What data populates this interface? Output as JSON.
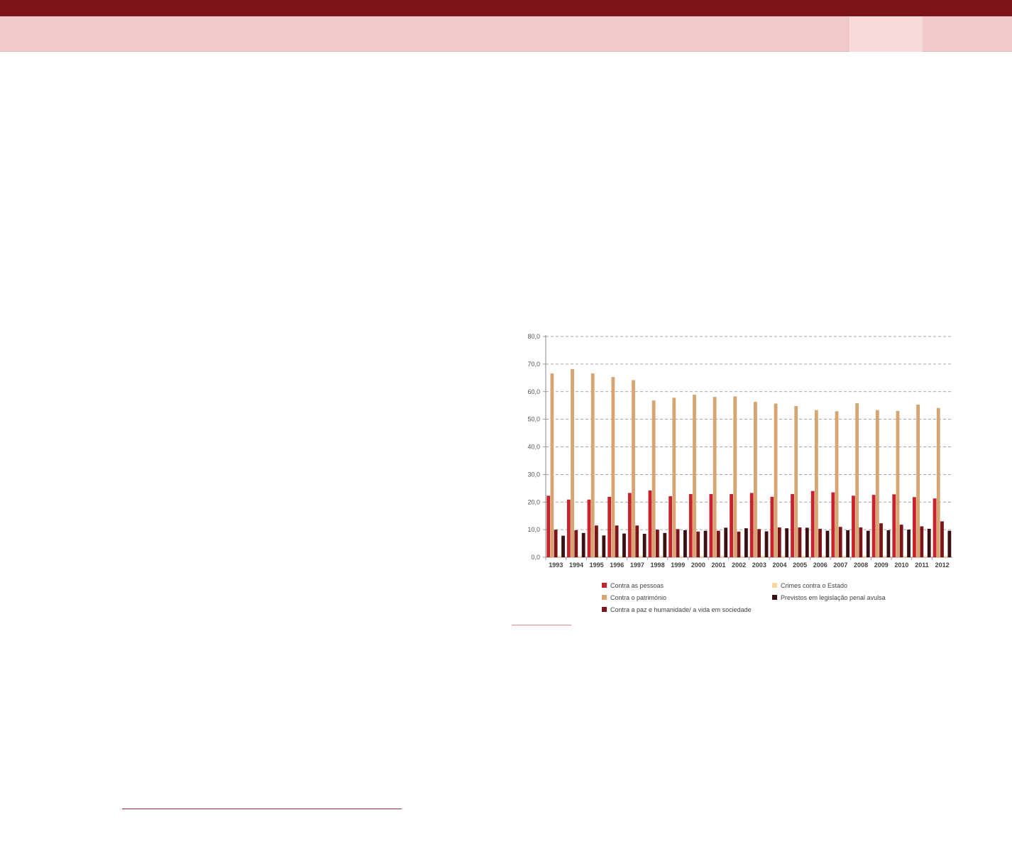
{
  "colors": {
    "header_dark": "#7d1518",
    "header_light": "#f2c9ca",
    "accent_rule": "#a3272b"
  },
  "chart_data": {
    "type": "bar",
    "categories": [
      "1993",
      "1994",
      "1995",
      "1996",
      "1997",
      "1998",
      "1999",
      "2000",
      "2001",
      "2002",
      "2003",
      "2004",
      "2005",
      "2006",
      "2007",
      "2008",
      "2009",
      "2010",
      "2011",
      "2012"
    ],
    "ylim": [
      0,
      80
    ],
    "yticks": [
      "0,0",
      "10,0",
      "20,0",
      "30,0",
      "40,0",
      "50,0",
      "60,0",
      "70,0",
      "80,0"
    ],
    "grid": true,
    "legend_position": "bottom",
    "series": [
      {
        "name": "Contra as pessoas",
        "color": "#c8232c",
        "values": [
          22.3,
          20.9,
          20.9,
          21.9,
          23.3,
          24.2,
          22.1,
          22.9,
          22.9,
          22.9,
          23.3,
          21.9,
          22.9,
          24.0,
          23.5,
          22.3,
          22.6,
          22.8,
          21.8,
          21.3
        ]
      },
      {
        "name": "Contra o património",
        "color": "#d6a572",
        "values": [
          66.6,
          68.2,
          66.6,
          65.3,
          64.2,
          56.8,
          57.8,
          58.9,
          58.1,
          58.3,
          56.3,
          55.7,
          54.8,
          53.3,
          52.9,
          55.8,
          53.3,
          53.0,
          55.3,
          54.1
        ]
      },
      {
        "name": "Contra a paz e humanidade/ a vida em sociedade",
        "color": "#7d1518",
        "values": [
          10.0,
          9.8,
          11.5,
          11.5,
          11.5,
          10.0,
          10.2,
          9.3,
          9.6,
          9.3,
          10.2,
          10.8,
          10.8,
          10.3,
          11.0,
          10.8,
          12.3,
          11.8,
          11.2,
          13.0
        ]
      },
      {
        "name": "Crimes contra o Estado",
        "color": "#f7d6a0",
        "values": [
          0.5,
          0.5,
          0.5,
          0.5,
          0.5,
          0.5,
          0.5,
          0.5,
          0.5,
          0.5,
          0.5,
          0.5,
          0.5,
          0.5,
          0.5,
          0.5,
          0.5,
          0.5,
          0.5,
          0.5
        ]
      },
      {
        "name": "Previstos em legislação penal avulsa",
        "color": "#3a1012",
        "values": [
          7.8,
          8.8,
          7.9,
          8.6,
          8.5,
          8.8,
          9.8,
          9.6,
          10.7,
          10.5,
          9.4,
          10.5,
          10.7,
          9.6,
          9.8,
          9.6,
          9.8,
          10.0,
          10.3,
          9.6
        ]
      }
    ]
  }
}
